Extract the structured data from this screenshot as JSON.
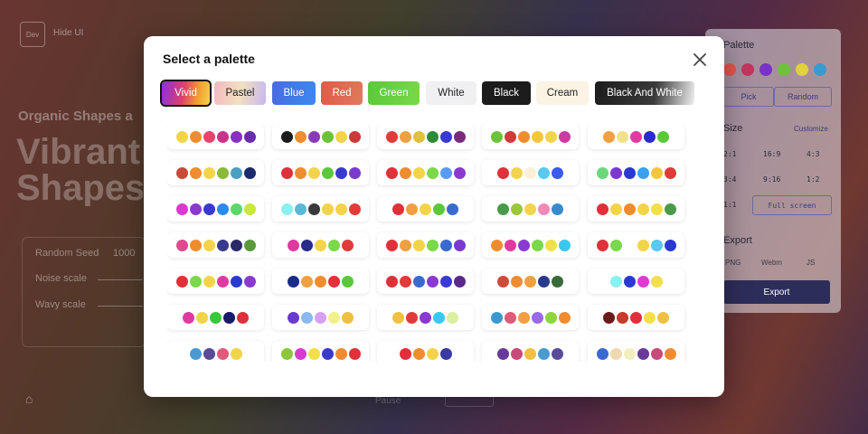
{
  "background": {
    "logo_text": "Dev",
    "hide_ui_label": "Hide UI",
    "subtitle": "Organic Shapes a",
    "title": "Vibrant Shapes",
    "controls": [
      {
        "label": "Random Seed",
        "value": "1000"
      },
      {
        "label": "Noise scale",
        "value": ""
      },
      {
        "label": "Wavy scale",
        "value": ""
      }
    ],
    "bottom_text": "Pause"
  },
  "side_panel": {
    "palette_title": "Palette",
    "palette_colors": [
      "#e2574c",
      "#c2365f",
      "#7a33c9",
      "#6ec23a",
      "#e0d23a",
      "#3a9bd1"
    ],
    "pick_label": "Pick",
    "random_label": "Random",
    "size_title": "Size",
    "customize_label": "Customize",
    "ratios": [
      "2:1",
      "16:9",
      "4:3",
      "3:4",
      "9:16",
      "1:2",
      "1:1"
    ],
    "full_screen_label": "Full screen",
    "export_title": "Export",
    "formats": [
      "PNG",
      "Webm",
      "JS"
    ],
    "export_button": "Export"
  },
  "modal": {
    "title": "Select a palette",
    "close_icon": "close-icon",
    "tabs": [
      {
        "label": "Vivid",
        "active": true
      },
      {
        "label": "Pastel",
        "active": false
      },
      {
        "label": "Blue",
        "active": false
      },
      {
        "label": "Red",
        "active": false
      },
      {
        "label": "Green",
        "active": false
      },
      {
        "label": "White",
        "active": false
      },
      {
        "label": "Black",
        "active": false
      },
      {
        "label": "Cream",
        "active": false
      },
      {
        "label": "Black And White",
        "active": false
      }
    ],
    "palettes": [
      [
        "#f2d44a",
        "#f08c30",
        "#e9436c",
        "#c9338a",
        "#8a2fc4",
        "#6a2bb0"
      ],
      [
        "#1c1c1c",
        "#f08c30",
        "#8a3ab8",
        "#6ec23a",
        "#f2d44a",
        "#c83a3a"
      ],
      [
        "#e03a3a",
        "#f0a040",
        "#e0c040",
        "#2e8a3a",
        "#3a3ad0",
        "#7a2a7a"
      ],
      [
        "#6ec23a",
        "#d03a3a",
        "#f08c30",
        "#f2c83a",
        "#f2d44a",
        "#d03aa0"
      ],
      [
        "#f0a040",
        "#f2e08a",
        "#e03aa0",
        "#2a2ad0",
        "#5ac83a"
      ],
      [
        "#c84a3a",
        "#f08c30",
        "#f2d44a",
        "#8ab83a",
        "#4aa0c0",
        "#1a2a6a"
      ],
      [
        "#e0303a",
        "#f08c30",
        "#f2d44a",
        "#5ac83a",
        "#3a3ad0",
        "#7a3ad0"
      ],
      [
        "#e0303a",
        "#f08c30",
        "#f2d44a",
        "#7ad84a",
        "#5a9af0",
        "#8a3ad0"
      ],
      [
        "#e0303a",
        "#f2d44a",
        "#faf0d8",
        "#5ac8f0",
        "#3a5af0"
      ],
      [
        "#6ad87a",
        "#7a3ad0",
        "#2a3ad0",
        "#3aa0f0",
        "#f2c83a",
        "#e03a3a"
      ],
      [
        "#d83ad0",
        "#8a3ad0",
        "#3a3ad0",
        "#2a8af0",
        "#5ad86a",
        "#c8e83a"
      ],
      [
        "#8af0f0",
        "#5ab8d8",
        "#3a3a3a",
        "#f2d44a",
        "#f2d44a",
        "#e03a3a"
      ],
      [
        "#e0303a",
        "#f0a040",
        "#f2d44a",
        "#5ac83a",
        "#3a6ad0"
      ],
      [
        "#4a9a4a",
        "#9ac83a",
        "#f2d44a",
        "#f08ab8",
        "#3a8ad0"
      ],
      [
        "#e0303a",
        "#f2d44a",
        "#f08c30",
        "#f2d44a",
        "#f2e04a",
        "#4a9a4a"
      ],
      [
        "#e04a8a",
        "#f08c30",
        "#f2d44a",
        "#3a3a8a",
        "#2a2a6a",
        "#5a9a3a"
      ],
      [
        "#e03aa0",
        "#2a2a8a",
        "#f2d44a",
        "#7ad84a",
        "#e03a3a"
      ],
      [
        "#e0303a",
        "#f0a040",
        "#f2d44a",
        "#7ad84a",
        "#3a6ad0",
        "#7a3ad0"
      ],
      [
        "#f08c30",
        "#e03aa0",
        "#8a3ad0",
        "#7ad84a",
        "#f2e04a",
        "#3ac8f0"
      ],
      [
        "#e0303a",
        "#7ad84a",
        "null",
        "#f2d44a",
        "#5ac8f0",
        "#2a3ad0"
      ],
      [
        "#e0303a",
        "#7ad84a",
        "#f2d44a",
        "#e03aa0",
        "#2a3ad0",
        "#8a3ad0"
      ],
      [
        "#1a2a8a",
        "#f0a040",
        "#f08c30",
        "#e0303a",
        "#5ac83a"
      ],
      [
        "#e0303a",
        "#e03a3a",
        "#3a6ad0",
        "#8a3ad0",
        "#3a3ad0",
        "#5a2a8a"
      ],
      [
        "#d04a3a",
        "#f08c30",
        "#f0a040",
        "#2a3a8a",
        "#3a6a3a"
      ],
      [
        "#8af0f0",
        "#2a3ad0",
        "#e03ad0",
        "#f2e04a"
      ],
      [
        "#e03aa0",
        "#f2d44a",
        "#3ac83a",
        "#1a1a6a",
        "#e0303a"
      ],
      [
        "#6a3ad0",
        "#8ab8f0",
        "#d8a0f0",
        "#f2f08a",
        "#f0c040"
      ],
      [
        "#f0c040",
        "#e03a3a",
        "#8a3ad0",
        "#3ac8f0",
        "#d8f0a0"
      ],
      [
        "#3a9ad0",
        "#e05a7a",
        "#f0a040",
        "#9a6ae0",
        "#8ad83a",
        "#f08c30"
      ],
      [
        "#6a1a1a",
        "#c83a2a",
        "#e0303a",
        "#f2e04a",
        "#f0c040"
      ],
      [
        "#4a9ad0",
        "#5a4a9a",
        "#e05a7a",
        "#f2d44a"
      ],
      [
        "#8ac83a",
        "#d83ad0",
        "#f2e04a",
        "#3a3ad0",
        "#f08c30",
        "#e0303a"
      ],
      [
        "#e0303a",
        "#f08c30",
        "#f2d44a",
        "#3a3aa0"
      ],
      [
        "#6a3a9a",
        "#c84a7a",
        "#f0c040",
        "#4a9ad0",
        "#5a4a9a"
      ],
      [
        "#3a6ad0",
        "#f0d8b0",
        "#f2f0c0",
        "#6a3a9a",
        "#c84a7a",
        "#f08c30"
      ]
    ]
  }
}
